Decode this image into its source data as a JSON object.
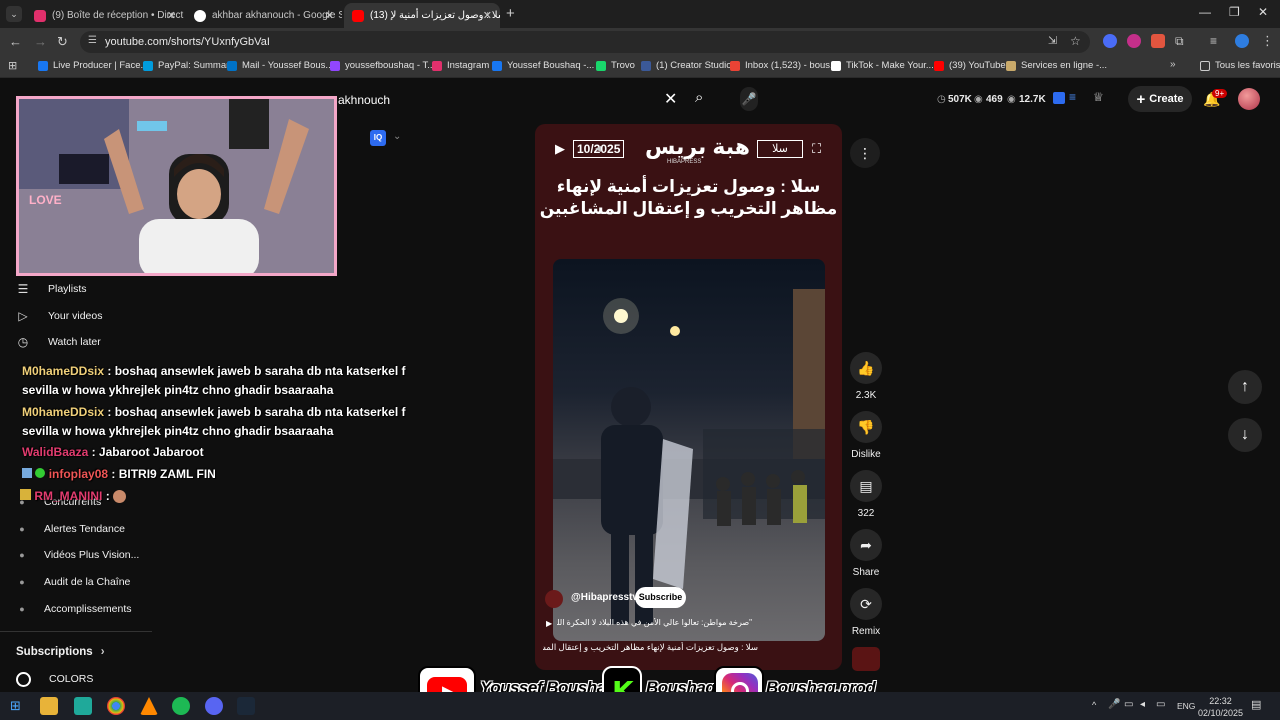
{
  "tabs": [
    {
      "label": "(9) Boîte de réception • Direct",
      "color": "#e1306c"
    },
    {
      "label": "akhbar akhanouch - Google Se",
      "color": "#ffffff"
    },
    {
      "label": "(13) سلا : وصول تعزيزات أمنية لإ",
      "color": "#ff0000"
    }
  ],
  "address": {
    "url": "youtube.com/shorts/YUxnfyGbVaI"
  },
  "bookmarks": [
    {
      "label": "Live Producer | Face...",
      "color": "#1877f2"
    },
    {
      "label": "PayPal: Summary",
      "color": "#009cde"
    },
    {
      "label": "Mail - Youssef Bous...",
      "color": "#0072c6"
    },
    {
      "label": "youssefboushaq - T...",
      "color": "#9146ff"
    },
    {
      "label": "Instagram",
      "color": "#e1306c"
    },
    {
      "label": "Youssef Boushaq -...",
      "color": "#1877f2"
    },
    {
      "label": "Trovo",
      "color": "#19d66b"
    },
    {
      "label": "(1) Creator Studio",
      "color": "#3b5998"
    },
    {
      "label": "Inbox (1,523) - bous...",
      "color": "#ea4335"
    },
    {
      "label": "TikTok - Make Your...",
      "color": "#ffffff"
    },
    {
      "label": "(39) YouTube",
      "color": "#ff0000"
    },
    {
      "label": "Services en ligne -...",
      "color": "#c8a96a"
    },
    {
      "label": "Tous les favoris",
      "color": "#cccccc"
    }
  ],
  "search": {
    "query": "akhnouch"
  },
  "header_stats": {
    "views": "507K",
    "watch": "469",
    "subs": "12.7K"
  },
  "create_label": "Create",
  "notif_count": "9+",
  "sidebar": {
    "items": [
      {
        "label": "Playlists",
        "icon": "playlist-icon"
      },
      {
        "label": "Your videos",
        "icon": "video-icon"
      },
      {
        "label": "Watch later",
        "icon": "clock-icon"
      }
    ],
    "lower_items": [
      {
        "label": "Concurrents"
      },
      {
        "label": "Alertes Tendance"
      },
      {
        "label": "Vidéos Plus Vision..."
      },
      {
        "label": "Audit de la Chaîne"
      },
      {
        "label": "Accomplissements"
      }
    ],
    "subscriptions_label": "Subscriptions",
    "colors_label": "COLORS"
  },
  "chat": [
    {
      "user": "M0hameDDsix",
      "msg": ": boshaq ansewlek jaweb b saraha db nta katserkel f",
      "cont": "sevilla w howa ykhrejlek pin4tz chno ghadir bsaaraaha"
    },
    {
      "user": "M0hameDDsix",
      "msg": ": boshaq ansewlek jaweb b saraha db nta katserkel f",
      "cont": "sevilla w howa ykhrejlek pin4tz chno ghadir bsaaraaha"
    },
    {
      "user": "WalidBaaza",
      "msg": ": Jabaroot Jabaroot"
    },
    {
      "user": "infoplay08",
      "msg": ": BITRI9 ZAML FIN"
    },
    {
      "user": "RM_MANINI",
      "msg": ":"
    }
  ],
  "video": {
    "date": "10/2025",
    "brand": "هبة بريس",
    "brand_sub": "HIBAPRESS",
    "city_tag": "سلا",
    "title": "سلا : وصول تعزيزات أمنية لإنهاء مظاهر التخريب و إعتقال المشاغبين",
    "channel": "@Hibapresstv",
    "subscribe": "Subscribe",
    "caption": "\"صرخة مواطن: تعالوا عالي الأمن في هذه البلاد لا الحكرة اللي رخيصة\"",
    "description": "سلا : وصول تعزيزات أمنية لإنهاء مظاهر التخريب و إعتقال المشاغبين"
  },
  "actions": {
    "likes": "2.3K",
    "dislike_label": "Dislike",
    "comments": "322",
    "share_label": "Share",
    "remix_label": "Remix"
  },
  "banner": {
    "youtube": "Youssef Boushaq",
    "kick": "Boushaq",
    "instagram": "Boushaq.prod"
  },
  "taskbar": {
    "lang": "ENG",
    "time": "22:32",
    "date": "02/10/2025"
  }
}
